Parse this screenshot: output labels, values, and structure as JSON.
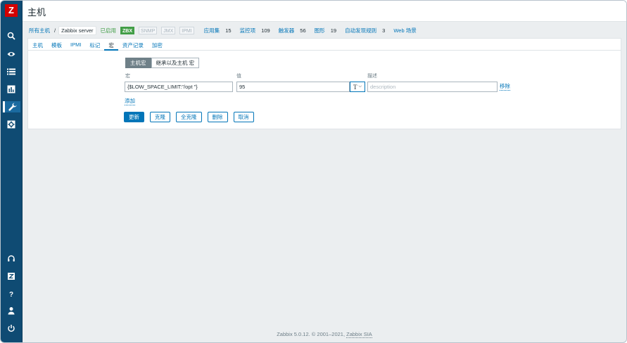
{
  "app": {
    "logo": "Z",
    "title": "主机"
  },
  "sidebar": {
    "icons": [
      "search-icon",
      "eye-icon",
      "list-icon",
      "chart-icon",
      "wrench-icon",
      "gear-icon",
      "headset-icon",
      "zabbix-icon",
      "help-icon",
      "user-icon",
      "power-icon"
    ]
  },
  "breadcrumb": {
    "all_hosts": "所有主机",
    "separator": "/",
    "current": "Zabbix server",
    "status": "已启用",
    "badges": [
      "ZBX",
      "SNMP",
      "JMX",
      "IPMI"
    ],
    "links": [
      {
        "label": "应用集",
        "count": "15"
      },
      {
        "label": "监控项",
        "count": "109"
      },
      {
        "label": "触发器",
        "count": "56"
      },
      {
        "label": "图形",
        "count": "19"
      },
      {
        "label": "自动发现规则",
        "count": "3"
      },
      {
        "label": "Web 场景",
        "count": ""
      }
    ]
  },
  "tabs": [
    "主机",
    "模板",
    "IPMI",
    "标记",
    "宏",
    "资产记录",
    "加密"
  ],
  "active_tab": "宏",
  "macro_mode": {
    "host_macros": "主机宏",
    "inherited": "继承以及主机 宏"
  },
  "columns": {
    "macro": "宏",
    "value": "值",
    "description": "描述"
  },
  "row": {
    "macro": "{$LOW_SPACE_LIMIT:\"/opt \"}",
    "value": "95",
    "type_symbol": "T",
    "description_placeholder": "description",
    "remove": "移除"
  },
  "add_link": "添加",
  "buttons": {
    "update": "更新",
    "clone": "克隆",
    "full_clone": "全克隆",
    "delete": "删除",
    "cancel": "取消"
  },
  "footer": {
    "text": "Zabbix 5.0.12. © 2001–2021, ",
    "company": "Zabbix SIA"
  },
  "colors": {
    "sidebar": "#0f4b73",
    "accent": "#0275b8",
    "enabled": "#429e47",
    "logo": "#d40000"
  }
}
